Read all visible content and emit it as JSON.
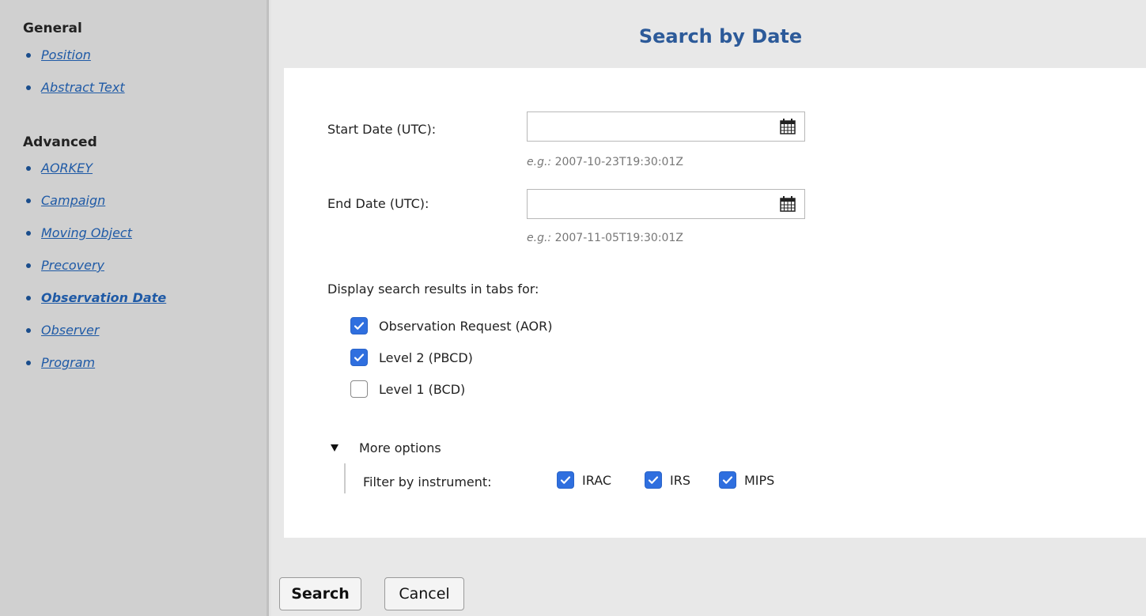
{
  "sidebar": {
    "general": {
      "title": "General",
      "items": [
        {
          "label": "Position",
          "active": false
        },
        {
          "label": "Abstract Text",
          "active": false
        }
      ]
    },
    "advanced": {
      "title": "Advanced",
      "items": [
        {
          "label": "AORKEY",
          "active": false
        },
        {
          "label": "Campaign",
          "active": false
        },
        {
          "label": "Moving Object",
          "active": false
        },
        {
          "label": "Precovery",
          "active": false
        },
        {
          "label": "Observation Date",
          "active": true
        },
        {
          "label": "Observer",
          "active": false
        },
        {
          "label": "Program",
          "active": false
        }
      ]
    }
  },
  "page": {
    "title": "Search by Date"
  },
  "form": {
    "start_date": {
      "label": "Start Date (UTC):",
      "value": "",
      "hint_prefix": "e.g.:",
      "hint_value": "2007-10-23T19:30:01Z"
    },
    "end_date": {
      "label": "End Date (UTC):",
      "value": "",
      "hint_prefix": "e.g.:",
      "hint_value": "2007-11-05T19:30:01Z"
    },
    "tabs_heading": "Display search results in tabs for:",
    "tabs": [
      {
        "label": "Observation Request (AOR)",
        "checked": true
      },
      {
        "label": "Level 2 (PBCD)",
        "checked": true
      },
      {
        "label": "Level 1 (BCD)",
        "checked": false
      }
    ],
    "more_options": {
      "label": "More options",
      "expanded": true,
      "filter_label": "Filter by instrument:",
      "instruments": [
        {
          "label": "IRAC",
          "checked": true
        },
        {
          "label": "IRS",
          "checked": true
        },
        {
          "label": "MIPS",
          "checked": true
        }
      ]
    }
  },
  "buttons": {
    "search": "Search",
    "cancel": "Cancel"
  },
  "colors": {
    "title": "#2c5a99",
    "link": "#1f5aa6",
    "checkbox_checked": "#2f6fdf"
  },
  "icons": {
    "calendar": "calendar-icon",
    "bullet": "bullet-icon",
    "checkmark": "checkmark-icon",
    "disclosure": "disclosure-triangle-icon"
  }
}
